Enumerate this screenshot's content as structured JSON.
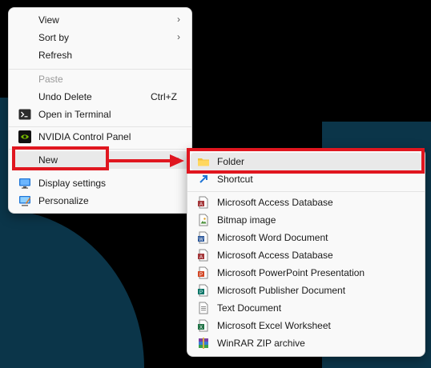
{
  "context_menu": {
    "items": [
      {
        "label": "View"
      },
      {
        "label": "Sort by"
      },
      {
        "label": "Refresh"
      },
      {
        "label": "Paste"
      },
      {
        "label": "Undo Delete",
        "shortcut": "Ctrl+Z"
      },
      {
        "label": "Open in Terminal"
      },
      {
        "label": "NVIDIA Control Panel"
      },
      {
        "label": "New"
      },
      {
        "label": "Display settings"
      },
      {
        "label": "Personalize"
      }
    ]
  },
  "new_submenu": {
    "items": [
      {
        "label": "Folder"
      },
      {
        "label": "Shortcut"
      },
      {
        "label": "Microsoft Access Database"
      },
      {
        "label": "Bitmap image"
      },
      {
        "label": "Microsoft Word Document"
      },
      {
        "label": "Microsoft Access Database"
      },
      {
        "label": "Microsoft PowerPoint Presentation"
      },
      {
        "label": "Microsoft Publisher Document"
      },
      {
        "label": "Text Document"
      },
      {
        "label": "Microsoft Excel Worksheet"
      },
      {
        "label": "WinRAR ZIP archive"
      }
    ]
  },
  "colors": {
    "highlight": "#e0161f",
    "desktop_accent": "#0b3549"
  }
}
